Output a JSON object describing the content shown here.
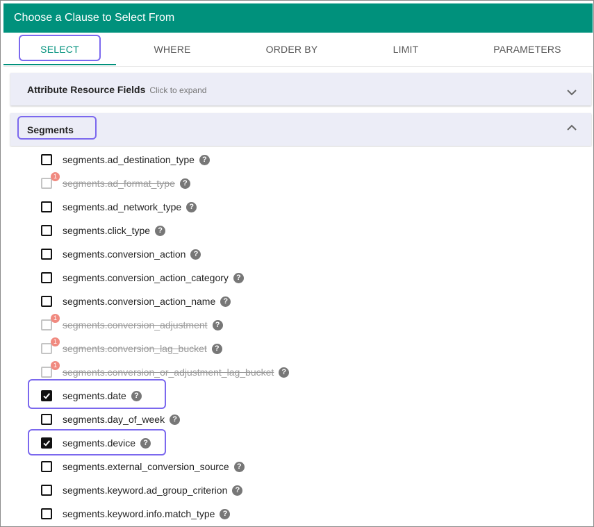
{
  "window": {
    "title": "Choose a Clause to Select From"
  },
  "tabs": [
    {
      "label": "SELECT",
      "active": true
    },
    {
      "label": "WHERE",
      "active": false
    },
    {
      "label": "ORDER BY",
      "active": false
    },
    {
      "label": "LIMIT",
      "active": false
    },
    {
      "label": "PARAMETERS",
      "active": false
    }
  ],
  "attribute_panel": {
    "title": "Attribute Resource Fields",
    "hint": "Click to expand",
    "expanded": false
  },
  "segments_panel": {
    "title": "Segments",
    "expanded": true
  },
  "fields": [
    {
      "label": "segments.ad_destination_type",
      "checked": false,
      "disabled": false,
      "badge": ""
    },
    {
      "label": "segments.ad_format_type",
      "checked": false,
      "disabled": true,
      "badge": "1"
    },
    {
      "label": "segments.ad_network_type",
      "checked": false,
      "disabled": false,
      "badge": ""
    },
    {
      "label": "segments.click_type",
      "checked": false,
      "disabled": false,
      "badge": ""
    },
    {
      "label": "segments.conversion_action",
      "checked": false,
      "disabled": false,
      "badge": ""
    },
    {
      "label": "segments.conversion_action_category",
      "checked": false,
      "disabled": false,
      "badge": ""
    },
    {
      "label": "segments.conversion_action_name",
      "checked": false,
      "disabled": false,
      "badge": ""
    },
    {
      "label": "segments.conversion_adjustment",
      "checked": false,
      "disabled": true,
      "badge": "1"
    },
    {
      "label": "segments.conversion_lag_bucket",
      "checked": false,
      "disabled": true,
      "badge": "1"
    },
    {
      "label": "segments.conversion_or_adjustment_lag_bucket",
      "checked": false,
      "disabled": true,
      "badge": "1"
    },
    {
      "label": "segments.date",
      "checked": true,
      "disabled": false,
      "badge": ""
    },
    {
      "label": "segments.day_of_week",
      "checked": false,
      "disabled": false,
      "badge": ""
    },
    {
      "label": "segments.device",
      "checked": true,
      "disabled": false,
      "badge": ""
    },
    {
      "label": "segments.external_conversion_source",
      "checked": false,
      "disabled": false,
      "badge": ""
    },
    {
      "label": "segments.keyword.ad_group_criterion",
      "checked": false,
      "disabled": false,
      "badge": ""
    },
    {
      "label": "segments.keyword.info.match_type",
      "checked": false,
      "disabled": false,
      "badge": ""
    }
  ],
  "help_glyph": "?",
  "colors": {
    "accent": "#00917c",
    "highlight": "#7b68ee",
    "badge": "#f08a80",
    "panel": "#ecedf7"
  }
}
